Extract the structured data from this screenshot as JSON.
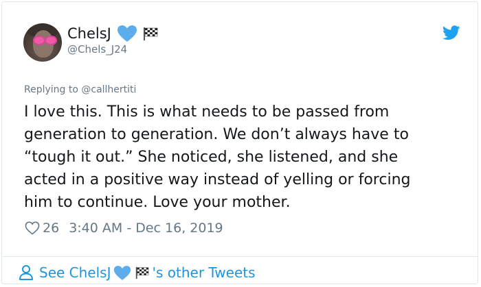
{
  "user": {
    "display_name": "ChelsJ",
    "handle": "@Chels_J24",
    "badges": [
      "blue-heart-icon",
      "checkered-flag-icon"
    ]
  },
  "tweet": {
    "replying_to": "Replying to @callhertiti",
    "text": "I love this. This is what needs to be passed from\ngeneration to generation. We don’t always have to\n“tough it out.” She noticed, she listened, and she\nacted in a positive way instead of yelling or forcing\nhim to continue. Love your mother.",
    "likes": "26",
    "timestamp": "3:40 AM - Dec 16, 2019"
  },
  "footer": {
    "see_prefix": "See ChelsJ",
    "see_suffix": "'s other Tweets"
  },
  "colors": {
    "twitter_blue": "#1da1f2",
    "link_blue": "#1b95e0",
    "heart_blue": "#5dadec",
    "secondary_text": "#657786",
    "primary_text": "#14171a"
  },
  "icons": {
    "brand": "twitter-bird-icon",
    "like": "heart-outline-icon",
    "profile": "user-outline-icon"
  }
}
